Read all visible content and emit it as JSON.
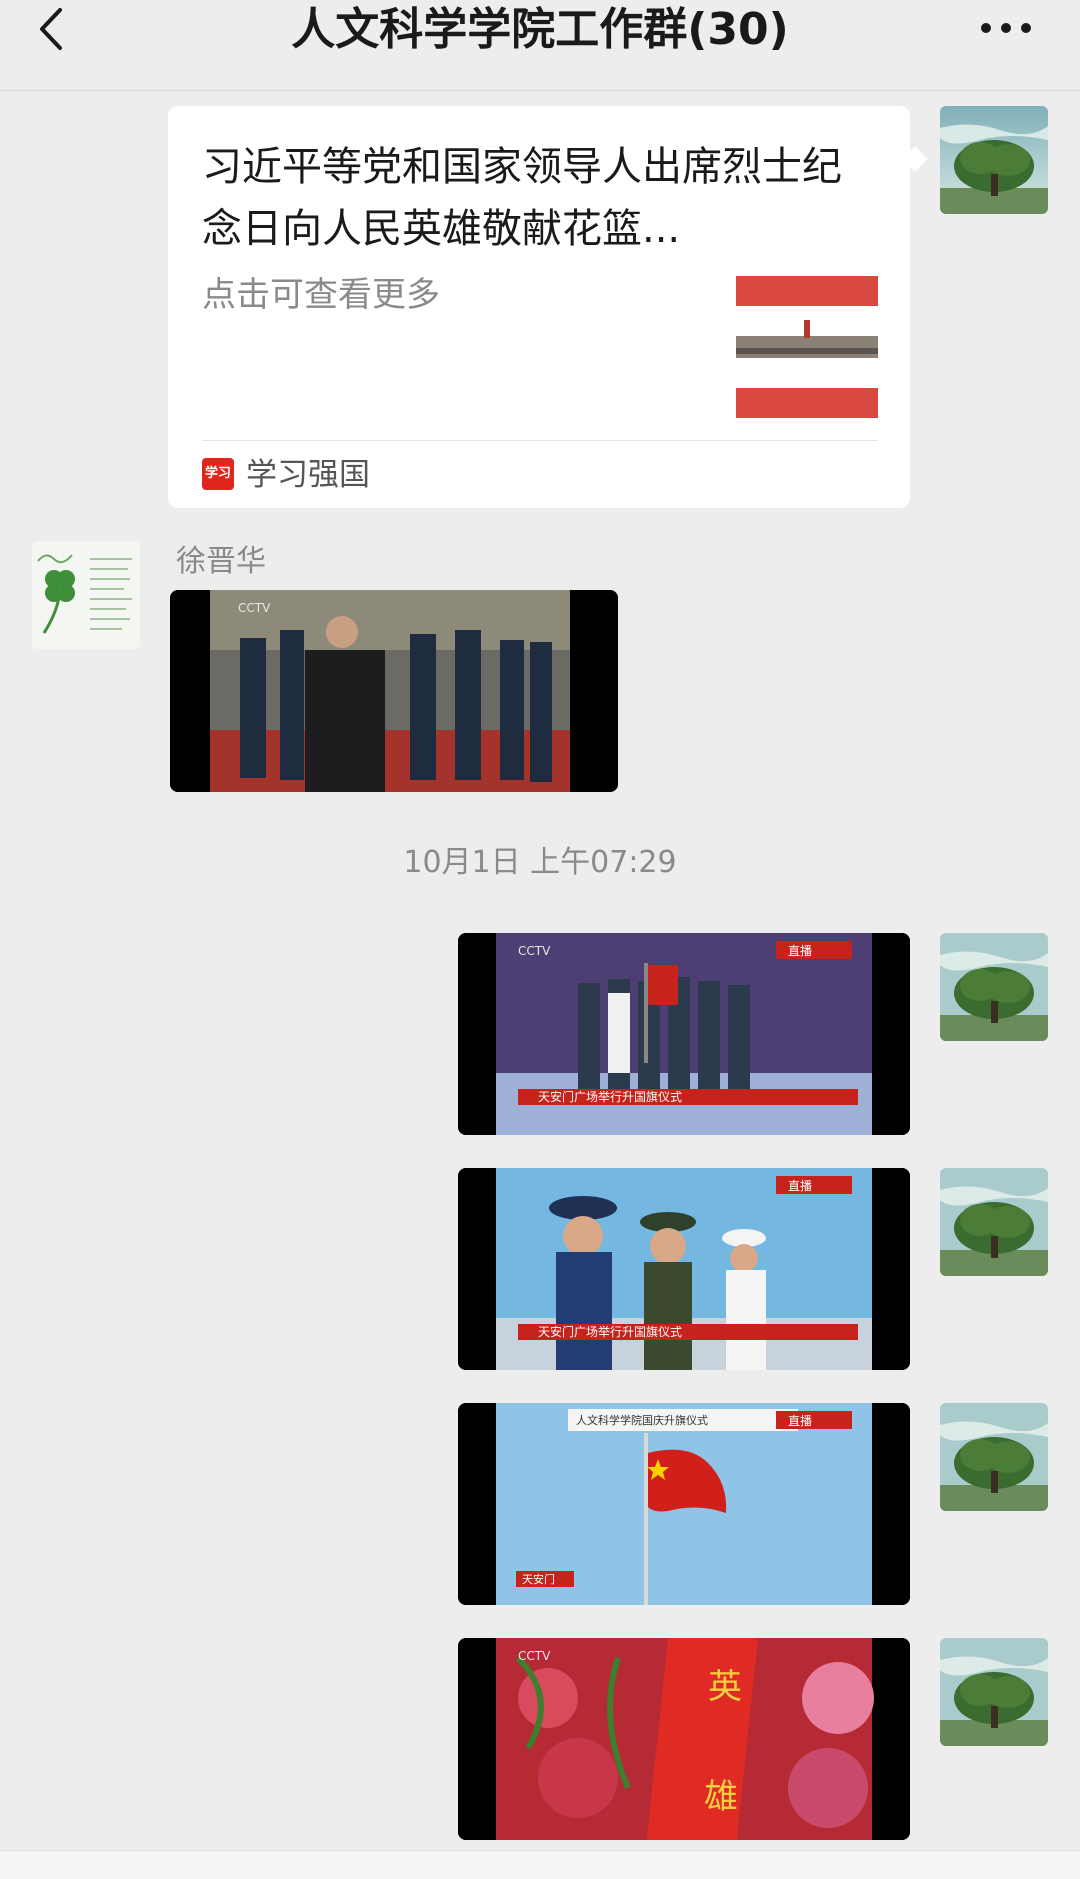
{
  "header": {
    "title": "人文科学学院工作群(30)"
  },
  "link_card": {
    "title": "习近平等党和国家领导人出席烈士纪念日向人民英雄敬献花篮...",
    "description": "点击可查看更多",
    "source_icon_text": "学习",
    "source": "学习强国"
  },
  "messages": {
    "sender_name": "徐晋华",
    "timestamp": "10月1日 上午07:29"
  },
  "video_overlays": {
    "cctv": "CCTV",
    "live_badge": "直播",
    "caption": "天安门广场举行升国旗仪式",
    "banner_left": "天安门",
    "banner_text": "人文科学学院国庆升旗仪式",
    "ribbon_chars": [
      "英",
      "雄"
    ]
  },
  "colors": {
    "background": "#ededed",
    "card": "#ffffff",
    "secondary_text": "#8a8a8a",
    "brand_red": "#e0261b"
  },
  "icons": [
    "chevron-left-icon",
    "more-icon",
    "xuexi-logo-icon",
    "tree-avatar-icon",
    "clover-avatar-icon"
  ]
}
